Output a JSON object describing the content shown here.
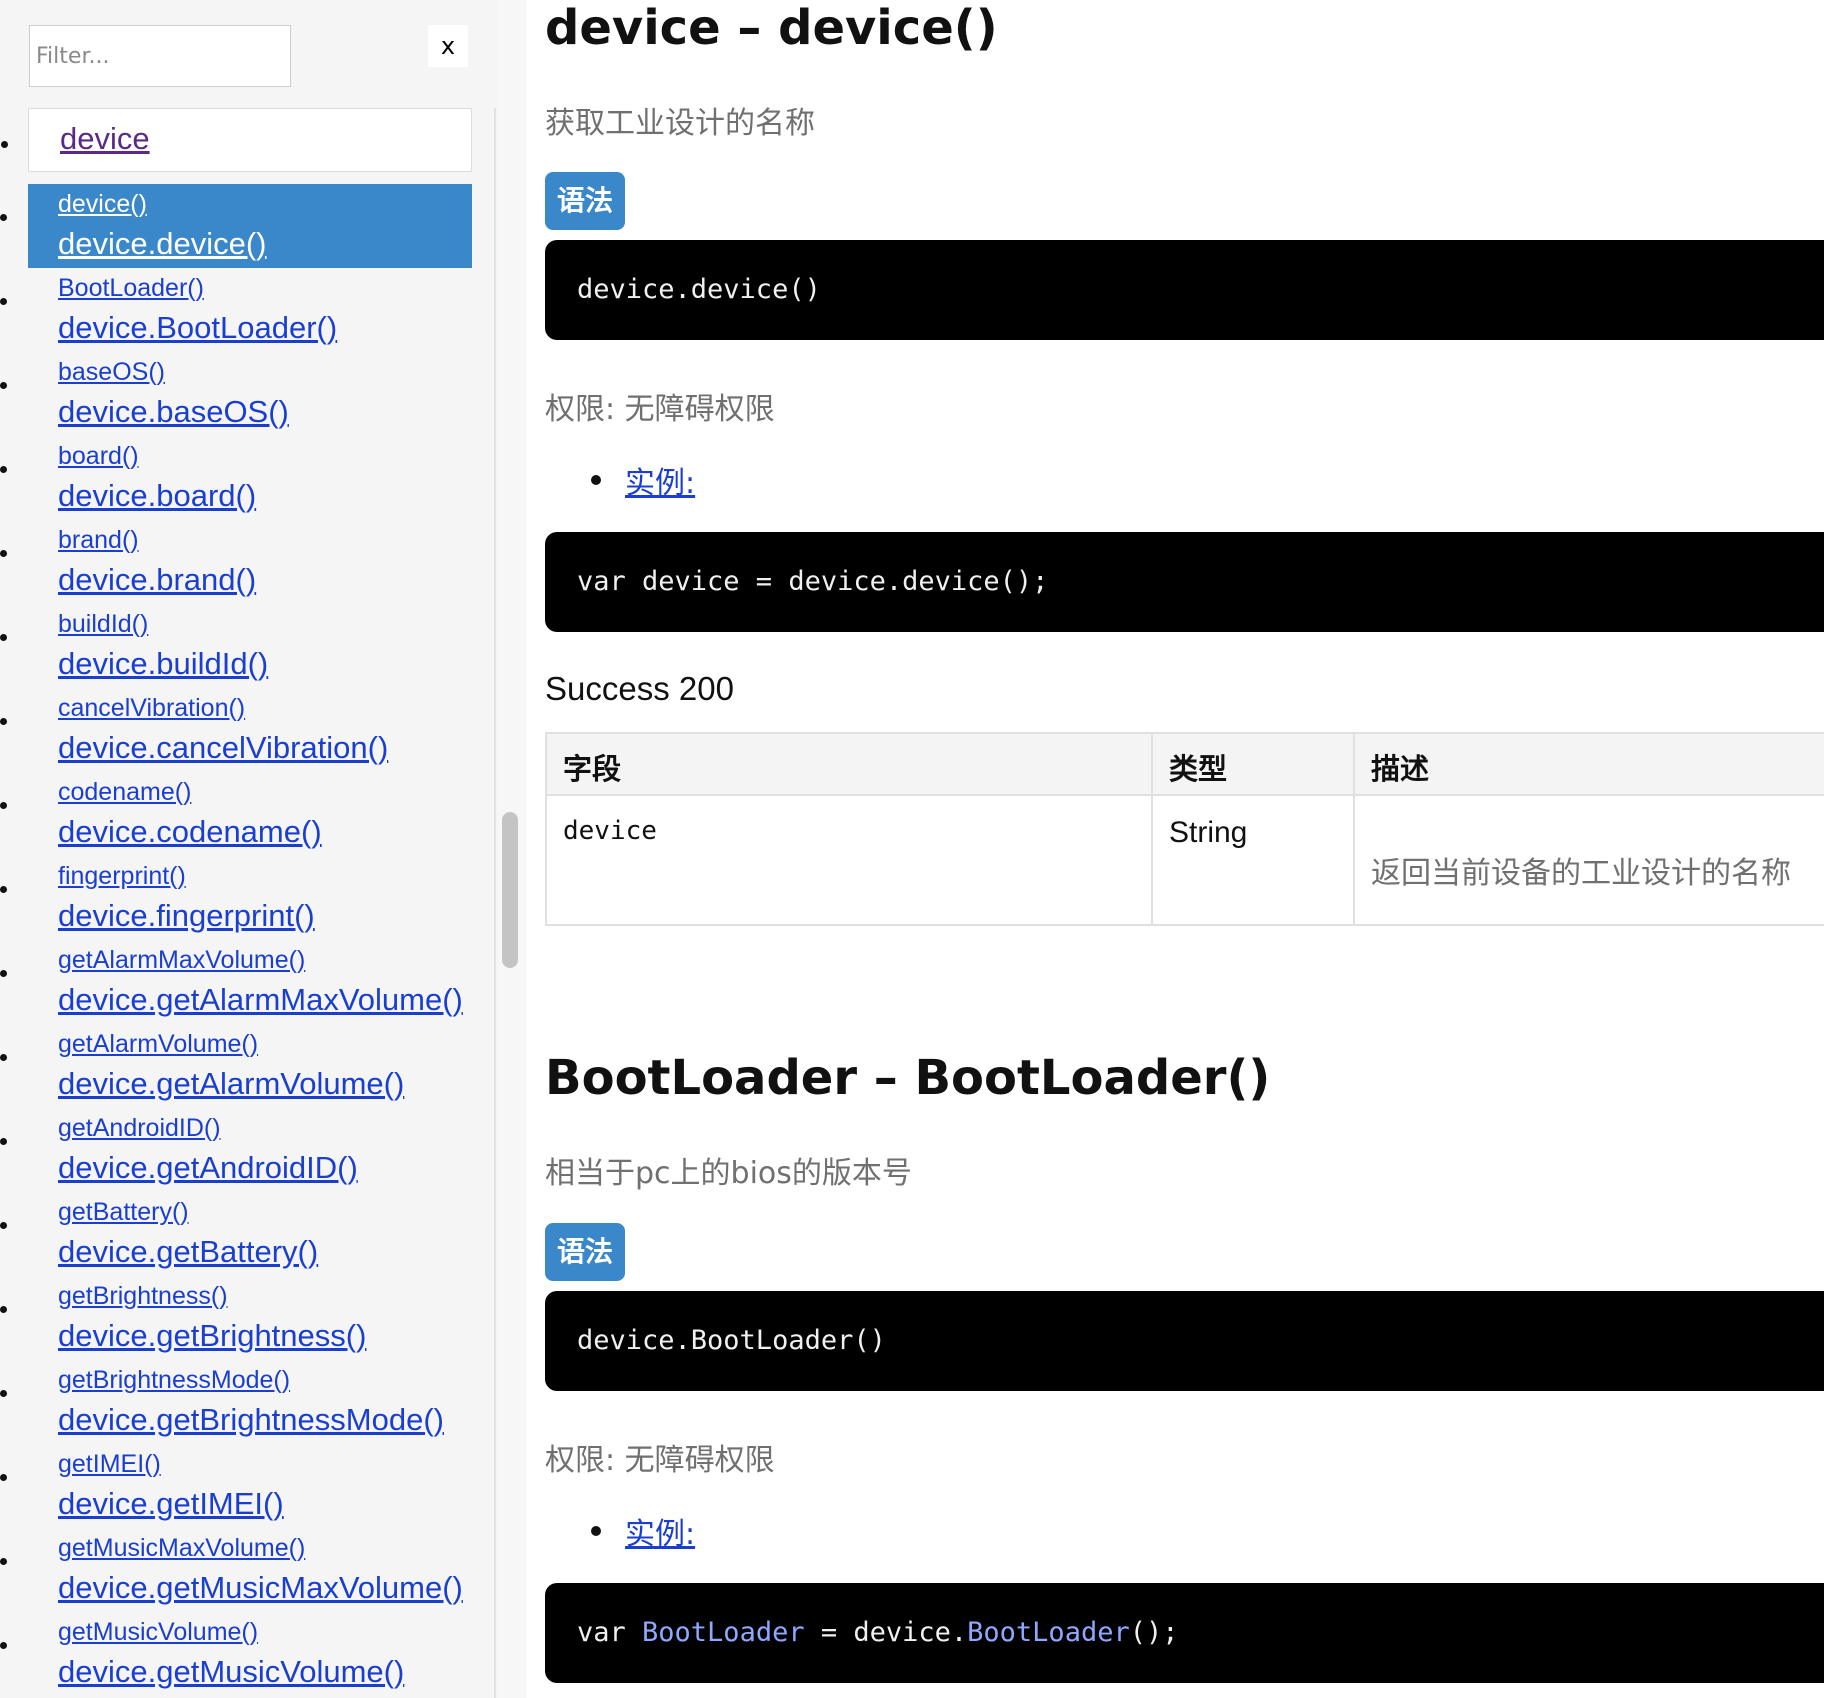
{
  "filter": {
    "placeholder": "Filter...",
    "clear_label": "x"
  },
  "sidebar": {
    "header": "device",
    "items": [
      {
        "short": "device()",
        "full": "device.device()"
      },
      {
        "short": "BootLoader()",
        "full": "device.BootLoader()"
      },
      {
        "short": "baseOS()",
        "full": "device.baseOS()"
      },
      {
        "short": "board()",
        "full": "device.board()"
      },
      {
        "short": "brand()",
        "full": "device.brand()"
      },
      {
        "short": "buildId()",
        "full": "device.buildId()"
      },
      {
        "short": "cancelVibration()",
        "full": "device.cancelVibration()"
      },
      {
        "short": "codename()",
        "full": "device.codename()"
      },
      {
        "short": "fingerprint()",
        "full": "device.fingerprint()"
      },
      {
        "short": "getAlarmMaxVolume()",
        "full": "device.getAlarmMaxVolume()"
      },
      {
        "short": "getAlarmVolume()",
        "full": "device.getAlarmVolume()"
      },
      {
        "short": "getAndroidID()",
        "full": "device.getAndroidID()"
      },
      {
        "short": "getBattery()",
        "full": "device.getBattery()"
      },
      {
        "short": "getBrightness()",
        "full": "device.getBrightness()"
      },
      {
        "short": "getBrightnessMode()",
        "full": "device.getBrightnessMode()"
      },
      {
        "short": "getIMEI()",
        "full": "device.getIMEI()"
      },
      {
        "short": "getMusicMaxVolume()",
        "full": "device.getMusicMaxVolume()"
      },
      {
        "short": "getMusicVolume()",
        "full": "device.getMusicVolume()"
      }
    ]
  },
  "section1": {
    "title": "device – device()",
    "description": "获取工业设计的名称",
    "syntax_label": "语法",
    "syntax_code": "device.device()",
    "permission": "权限: 无障碍权限",
    "example_label": "实例:",
    "example_code": "var device = device.device();",
    "success": "Success 200",
    "table": {
      "headers": [
        "字段",
        "类型",
        "描述"
      ],
      "row": {
        "field": "device",
        "type": "String",
        "description": "返回当前设备的工业设计的名称"
      }
    }
  },
  "section2": {
    "title": "BootLoader – BootLoader()",
    "description": "相当于pc上的bios的版本号",
    "syntax_label": "语法",
    "syntax_code": "device.BootLoader()",
    "permission": "权限: 无障碍权限",
    "example_label": "实例:",
    "example_code": {
      "kw": "var ",
      "var": "BootLoader",
      "mid": " = device.",
      "fn": "BootLoader",
      "end": "();"
    }
  }
}
